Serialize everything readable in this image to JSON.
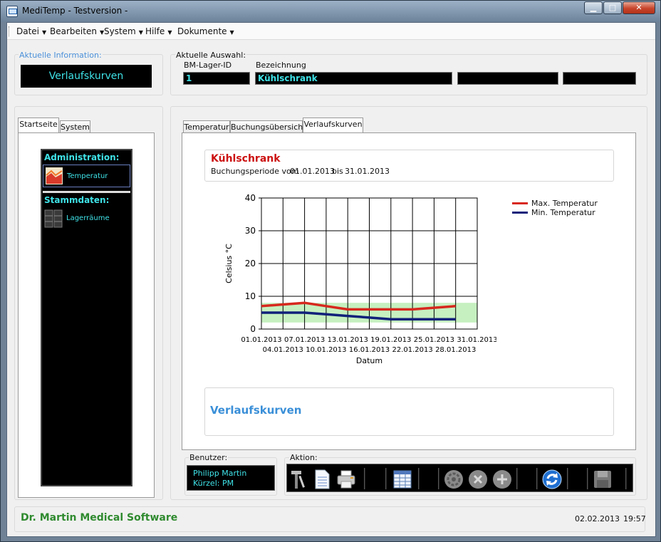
{
  "window": {
    "title": "MediTemp - Testversion -"
  },
  "menu": [
    {
      "label": "Datei"
    },
    {
      "label": "Bearbeiten"
    },
    {
      "label": "System"
    },
    {
      "label": "Hilfe"
    },
    {
      "label": "Dokumente"
    }
  ],
  "info": {
    "group_label": "Aktuelle Information:",
    "value": "Verlaufskurven"
  },
  "selection": {
    "group_label": "Aktuelle Auswahl:",
    "id_label": "BM-Lager-ID",
    "name_label": "Bezeichnung",
    "id_value": "1",
    "name_value": "Kühlschrank",
    "extra1": "",
    "extra2": ""
  },
  "left_tabs": [
    {
      "label": "Startseite"
    },
    {
      "label": "System"
    }
  ],
  "nav": {
    "section1": "Administration:",
    "item1": "Temperatur",
    "section2": "Stammdaten:",
    "item2": "Lagerräume"
  },
  "main_tabs": [
    {
      "label": "Temperatur"
    },
    {
      "label": "Buchungsübersicht"
    },
    {
      "label": "Verlaufskurven"
    }
  ],
  "header_card": {
    "title": "Kühlschrank",
    "period_text": "Buchungsperiode vom",
    "from": "01.01.2013",
    "bis": "bis",
    "to": "31.01.2013"
  },
  "chart_data": {
    "type": "line",
    "title": "",
    "xlabel": "Datum",
    "ylabel": "Celsius  °C",
    "ylim": [
      0,
      40
    ],
    "yticks": [
      "0",
      "10",
      "20",
      "30",
      "40"
    ],
    "x": [
      "01.01.2013",
      "04.01.2013",
      "07.01.2013",
      "10.01.2013",
      "13.01.2013",
      "16.01.2013",
      "19.01.2013",
      "22.01.2013",
      "25.01.2013",
      "28.01.2013",
      "31.01.2013"
    ],
    "xticks_top": [
      "01.01.2013",
      "07.01.2013",
      "13.01.2013",
      "19.01.2013",
      "25.01.2013",
      "31.01.2013"
    ],
    "xticks_bottom": [
      "04.01.2013",
      "10.01.2013",
      "16.01.2013",
      "22.01.2013",
      "28.01.2013"
    ],
    "band": [
      2,
      8
    ],
    "series": [
      {
        "name": "Max. Temperatur",
        "color": "#d7281e",
        "values": [
          7,
          7.5,
          8,
          7,
          6,
          6,
          6,
          6,
          6.5,
          7
        ]
      },
      {
        "name": "Min. Temperatur",
        "color": "#10207a",
        "values": [
          5,
          5,
          5,
          4.5,
          4,
          3.5,
          3,
          3,
          3,
          3
        ]
      }
    ],
    "grid": true,
    "legend_placement": "top-right",
    "band_color": "#c6f0c0"
  },
  "footer_card": {
    "title": "Verlaufskurven"
  },
  "user": {
    "group_label": "Benutzer:",
    "name": "Philipp Martin",
    "kuerzel": "Kürzel: PM"
  },
  "actions": {
    "group_label": "Aktion:"
  },
  "status": {
    "brand": "Dr. Martin Medical Software",
    "date": "02.02.2013",
    "time": "19:57"
  },
  "colors": {
    "accent": "#3fe3e8",
    "brand": "#2f8a2f",
    "title_red": "#cc1111",
    "link_blue": "#3a8fd8"
  }
}
